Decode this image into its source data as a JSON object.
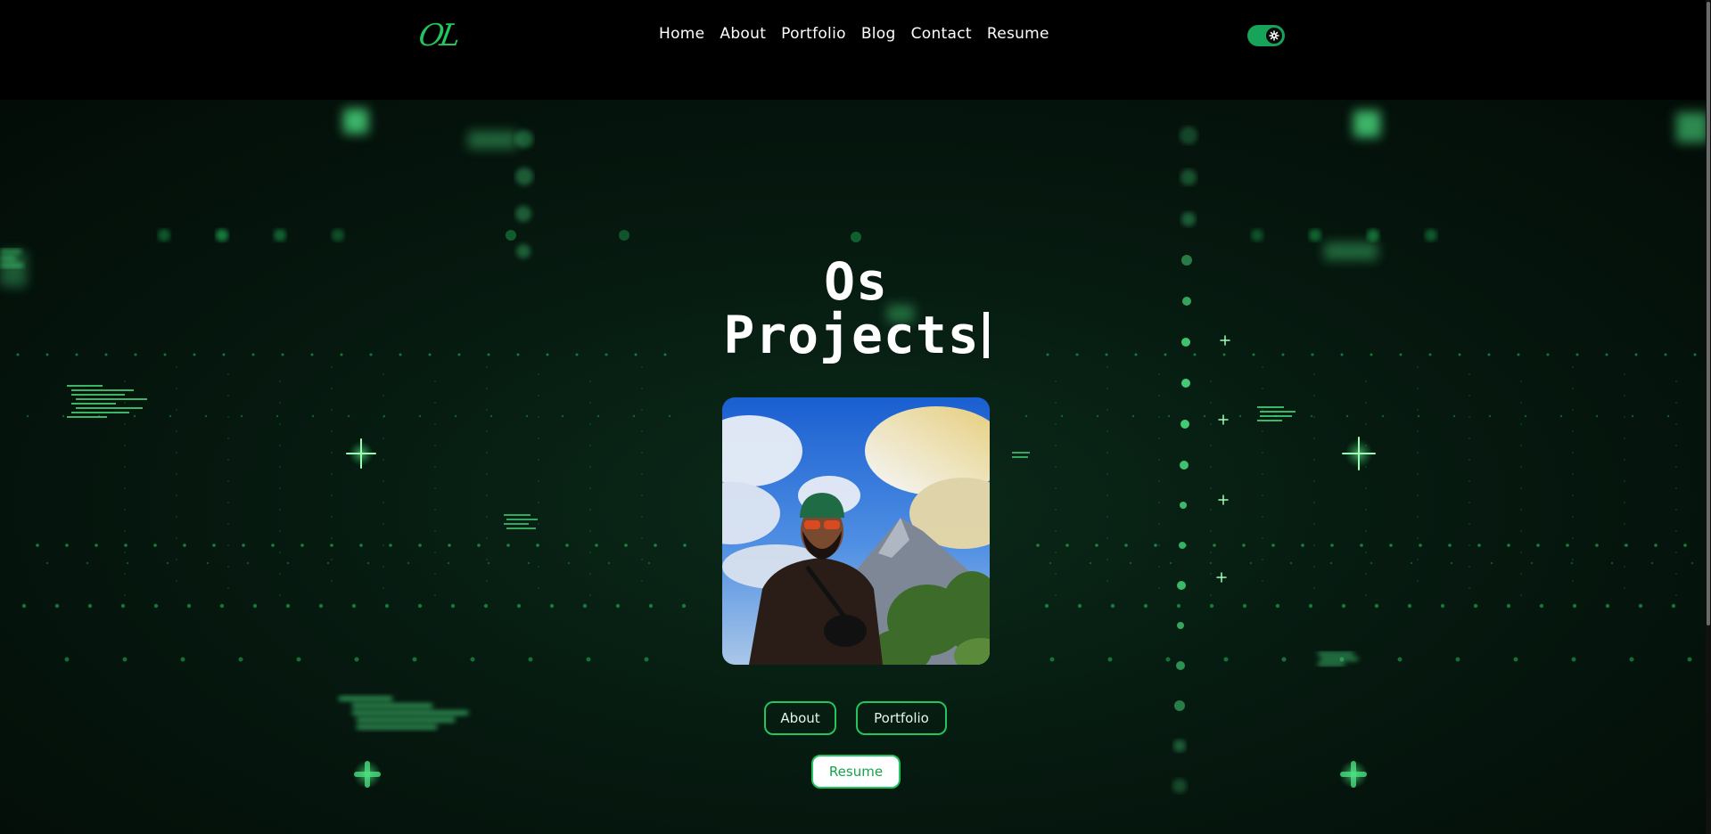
{
  "header": {
    "logo_text": "OL",
    "nav": [
      {
        "label": "Home"
      },
      {
        "label": "About"
      },
      {
        "label": "Portfolio"
      },
      {
        "label": "Blog"
      },
      {
        "label": "Contact"
      },
      {
        "label": "Resume"
      }
    ],
    "theme_toggle": {
      "state": "on",
      "icon": "gear-icon"
    }
  },
  "hero": {
    "title_line1": "Os",
    "title_line2": "Projects",
    "photo": {
      "icon": "profile-photo"
    },
    "buttons": {
      "about": "About",
      "portfolio": "Portfolio",
      "resume": "Resume"
    }
  },
  "colors": {
    "accent": "#22c55e",
    "background": "#000000",
    "hero_bg": "#061a10",
    "text": "#ffffff"
  }
}
